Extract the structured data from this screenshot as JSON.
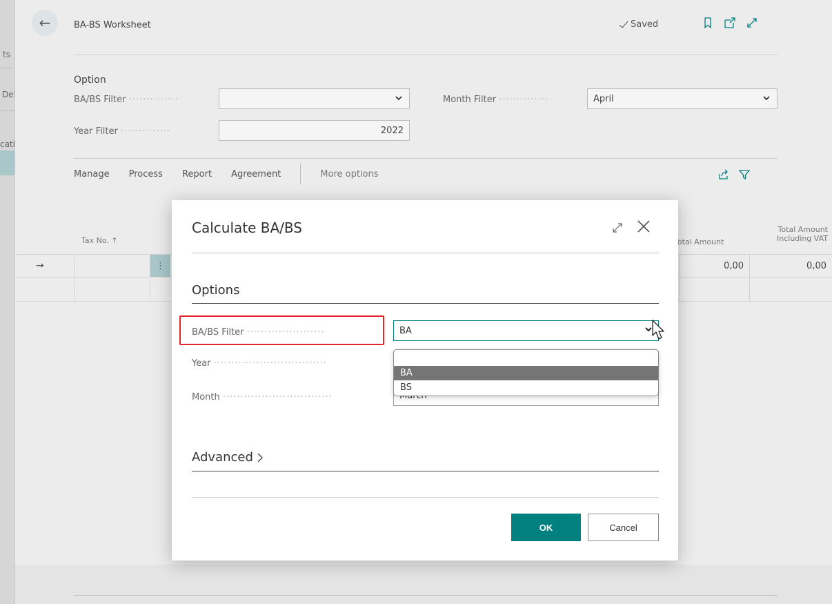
{
  "left_strip": {
    "fragments": [
      "ts",
      "Del",
      "cati"
    ]
  },
  "header": {
    "back_glyph": "←",
    "title": "BA-BS Worksheet",
    "saved_label": "Saved"
  },
  "options": {
    "heading": "Option",
    "babs_filter_label": "BA/BS Filter",
    "babs_filter_value": "",
    "month_filter_label": "Month Filter",
    "month_filter_value": "April",
    "year_filter_label": "Year Filter",
    "year_filter_value": "2022"
  },
  "menu": {
    "items": [
      "Manage",
      "Process",
      "Report",
      "Agreement"
    ],
    "more": "More options"
  },
  "grid": {
    "col_tax_no": "Tax No. ↑",
    "col_total_amount": "Total Amount",
    "col_total_incl_line1": "Total Amount",
    "col_total_incl_line2": "Including VAT",
    "row_arrow": "→",
    "row_total": "0,00",
    "row_total_incl": "0,00"
  },
  "dialog": {
    "title": "Calculate BA/BS",
    "options_heading": "Options",
    "babs_label": "BA/BS Filter",
    "babs_value": "BA",
    "year_label": "Year",
    "month_label": "Month",
    "month_value": "March",
    "dropdown_options": [
      "",
      "BA",
      "BS"
    ],
    "dropdown_selected": "BA",
    "advanced_label": "Advanced",
    "ok_label": "OK",
    "cancel_label": "Cancel"
  },
  "colors": {
    "accent": "#00807f",
    "highlight": "#e2262b",
    "selected_option": "#757575"
  }
}
